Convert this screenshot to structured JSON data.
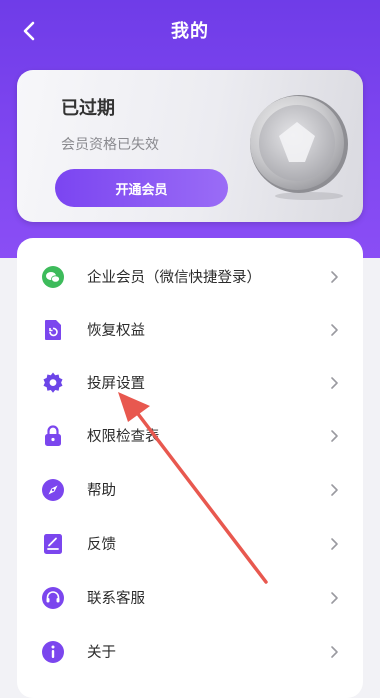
{
  "header": {
    "title": "我的"
  },
  "vip": {
    "status": "已过期",
    "description": "会员资格已失效",
    "button_label": "开通会员"
  },
  "menu": [
    {
      "label": "企业会员（微信快捷登录）",
      "icon": "wechat-icon",
      "color": "#3dbb5b"
    },
    {
      "label": "恢复权益",
      "icon": "restore-icon",
      "color": "#7b46ee"
    },
    {
      "label": "投屏设置",
      "icon": "gear-icon",
      "color": "#6c45e8"
    },
    {
      "label": "权限检查表",
      "icon": "lock-icon",
      "color": "#7b46ee"
    },
    {
      "label": "帮助",
      "icon": "compass-icon",
      "color": "#7b46ee"
    },
    {
      "label": "反馈",
      "icon": "feedback-icon",
      "color": "#7b46ee"
    },
    {
      "label": "联系客服",
      "icon": "headset-icon",
      "color": "#7b46ee"
    },
    {
      "label": "关于",
      "icon": "info-icon",
      "color": "#7b46ee"
    }
  ],
  "colors": {
    "accent": "#7b46ee",
    "annotation_arrow": "#e8584f"
  }
}
